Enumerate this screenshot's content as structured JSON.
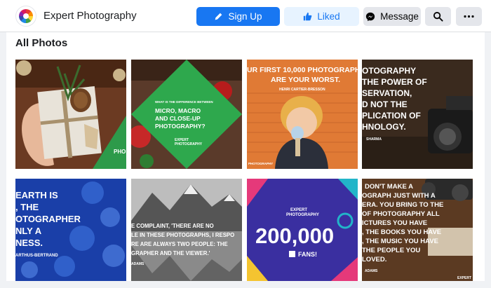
{
  "header": {
    "page_name": "Expert Photography",
    "buttons": {
      "signup": "Sign Up",
      "liked": "Liked",
      "message": "Message"
    },
    "icons": {
      "signup": "pencil-icon",
      "liked": "thumbs-up-icon",
      "message": "messenger-icon",
      "search": "search-icon",
      "more": "more-icon"
    }
  },
  "section": {
    "title": "All Photos"
  },
  "photos": [
    {
      "name": "gift-box-pine-cone",
      "text": [
        "PHO"
      ]
    },
    {
      "name": "micro-macro-closeup",
      "text": [
        "WHAT IS THE DIFFERENCE BETWEEN",
        "MICRO, MACRO",
        "AND CLOSE-UP",
        "PHOTOGRAPHY?",
        "EXPERT",
        "PHOTOGRAPHY"
      ]
    },
    {
      "name": "first-10000-photographs",
      "text": [
        "UR FIRST 10,000 PHOTOGRAPH",
        "ARE YOUR WORST.",
        "HENRI CARTIER-BRESSON",
        "PHOTOGRAPHY"
      ]
    },
    {
      "name": "power-of-observation",
      "text": [
        "OTOGRAPHY",
        "THE POWER OF",
        "SERVATION,",
        "D NOT THE",
        "PLICATION OF",
        "HNOLOGY.",
        "SHARMA"
      ]
    },
    {
      "name": "earth-jellyfish",
      "text": [
        "EARTH IS",
        ", THE",
        "OTOGRAPHER",
        "NLY A",
        "NESS.",
        "ARTHUS-BERTRAND"
      ]
    },
    {
      "name": "mountain-lake-quote",
      "text": [
        "E COMPLAINT, 'THERE ARE NO",
        "LE IN THESE PHOTOGRAPHS, I RESPO",
        "RE ARE ALWAYS TWO PEOPLE: THE",
        "GRAPHER AND THE VIEWER.'",
        "ADAMS"
      ]
    },
    {
      "name": "200000-fans",
      "text": [
        "EXPERT",
        "PHOTOGRAPHY",
        "200,000",
        "FANS!"
      ]
    },
    {
      "name": "camera-quote",
      "text": [
        "DON'T MAKE A",
        "OGRAPH JUST WITH A",
        "ERA. YOU BRING TO THE",
        "OF PHOTOGRAPHY ALL",
        "ICTURES YOU HAVE",
        ", THE BOOKS YOU HAVE",
        ", THE MUSIC YOU HAVE",
        "THE PEOPLE YOU",
        "LOVED.",
        "ADAMS",
        "EXPERT"
      ]
    }
  ]
}
